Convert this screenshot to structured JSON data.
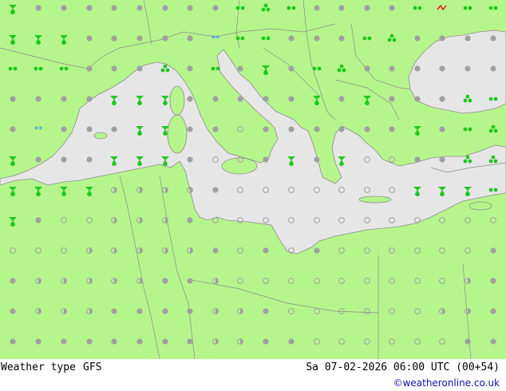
{
  "map": {
    "colors": {
      "land": "#b6f58c",
      "sea": "#e6e6e6",
      "border": "#8c8c8c",
      "coast": "#8c8c8c",
      "dot_cloud": "#a0a0a0",
      "precip_green": "#1ec81e",
      "snow_blue": "#1e90ff",
      "thunder_red": "#e61e1e"
    },
    "symbol_legend": [
      "overcast",
      "partly-cloudy",
      "clear",
      "drizzle",
      "rain-shower",
      "heavy-rain-shower",
      "snow",
      "thunderstorm"
    ]
  },
  "footer": {
    "product": "Weather type",
    "model": "GFS",
    "valid_time": "Sa 07-02-2026 06:00 UTC (00+54)",
    "credit": "©weatheronline.co.uk"
  }
}
